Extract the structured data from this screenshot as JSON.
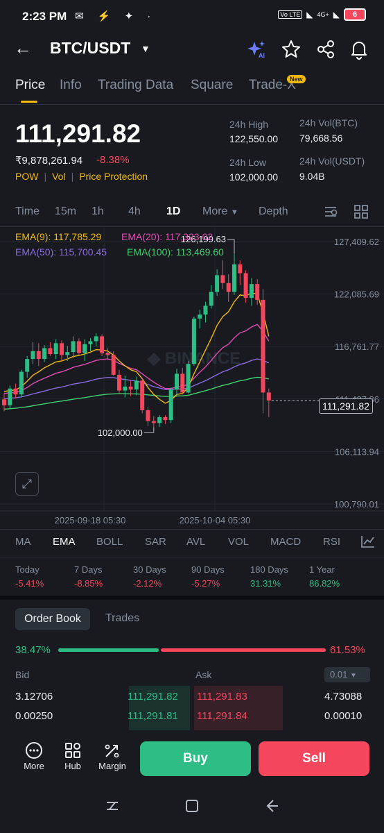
{
  "status_bar": {
    "time": "2:23 PM",
    "left_icons": "✉ ⚡ ✦ ·",
    "net1": "Vo LTE",
    "net2": "4G+",
    "battery": "6"
  },
  "header": {
    "pair": "BTC/USDT",
    "icons": [
      "ai-sparkle-icon",
      "star-icon",
      "share-icon",
      "bell-icon"
    ]
  },
  "tabs": [
    {
      "label": "Price"
    },
    {
      "label": "Info"
    },
    {
      "label": "Trading Data"
    },
    {
      "label": "Square"
    },
    {
      "label": "Trade-X"
    }
  ],
  "tab_badge": "New",
  "price": {
    "last": "111,291.82",
    "inr": "₹9,878,261.94",
    "change": "-8.38%",
    "tags": [
      "POW",
      "Vol",
      "Price Protection"
    ]
  },
  "stats": {
    "high_label": "24h High",
    "high_value": "122,550.00",
    "low_label": "24h Low",
    "low_value": "102,000.00",
    "vol_btc_label": "24h Vol(BTC)",
    "vol_btc_value": "79,668.56",
    "vol_usdt_label": "24h Vol(USDT)",
    "vol_usdt_value": "9.04B"
  },
  "timeframes": [
    "Time",
    "15m",
    "1h",
    "4h",
    "1D",
    "More",
    "Depth"
  ],
  "active_timeframe": "1D",
  "chart_data": {
    "type": "candlestick",
    "watermark": "BINANCE",
    "ema_labels": {
      "ema9": "EMA(9): 117,785.29",
      "ema20": "EMA(20): 117,323.02",
      "ema50": "EMA(50): 115,700.45",
      "ema100": "EMA(100): 113,469.60"
    },
    "colors": {
      "ema9": "#f0b90b",
      "ema20": "#e04bb3",
      "ema50": "#8c6ce0",
      "ema100": "#3fd16f",
      "up": "#2ebd85",
      "down": "#f6465d"
    },
    "y_ticks": [
      "127,409.62",
      "122,085.69",
      "116,761.77",
      "111,437.86",
      "106,113.94",
      "100,790.01"
    ],
    "x_ticks": [
      "2025-09-18 05:30",
      "2025-10-04 05:30"
    ],
    "ylim": [
      100790.01,
      127409.62
    ],
    "current_price": "111,291.82",
    "max_label": "126,199.63",
    "min_label": "102,000.00",
    "candles": [
      [
        111400,
        112000,
        110200,
        110800
      ],
      [
        110800,
        112800,
        110500,
        112500
      ],
      [
        112500,
        113000,
        111500,
        111900
      ],
      [
        111900,
        114400,
        111600,
        114200
      ],
      [
        114200,
        115800,
        113600,
        115500
      ],
      [
        115500,
        117200,
        115000,
        116300
      ],
      [
        116300,
        117100,
        114800,
        115500
      ],
      [
        115500,
        116900,
        115200,
        116600
      ],
      [
        116600,
        117200,
        115800,
        116000
      ],
      [
        116000,
        117500,
        115500,
        117100
      ],
      [
        117100,
        117400,
        115300,
        115900
      ],
      [
        115900,
        116800,
        115300,
        116200
      ],
      [
        116200,
        117800,
        115600,
        117300
      ],
      [
        117300,
        117600,
        115900,
        116100
      ],
      [
        116100,
        117500,
        115300,
        117000
      ],
      [
        117000,
        117600,
        116300,
        117300
      ],
      [
        117300,
        118100,
        116800,
        117800
      ],
      [
        117800,
        118000,
        115800,
        116100
      ],
      [
        116100,
        116600,
        115500,
        115900
      ],
      [
        115900,
        116300,
        113800,
        113900
      ],
      [
        113900,
        114400,
        112000,
        112300
      ],
      [
        112300,
        113800,
        111600,
        112700
      ],
      [
        112700,
        113300,
        111700,
        112400
      ],
      [
        112400,
        113700,
        111800,
        113300
      ],
      [
        113300,
        113600,
        110000,
        110300
      ],
      [
        110300,
        110600,
        108700,
        109200
      ],
      [
        109200,
        109700,
        108600,
        109000
      ],
      [
        109000,
        109800,
        108600,
        109600
      ],
      [
        109600,
        109800,
        108900,
        109300
      ],
      [
        109300,
        112600,
        109000,
        112400
      ],
      [
        112400,
        114500,
        111800,
        114000
      ],
      [
        114000,
        114600,
        111900,
        112100
      ],
      [
        112100,
        115300,
        112000,
        115000
      ],
      [
        115000,
        119800,
        114800,
        119600
      ],
      [
        119600,
        120500,
        118600,
        120000
      ],
      [
        120000,
        121300,
        119200,
        120900
      ],
      [
        120900,
        123000,
        120600,
        122300
      ],
      [
        122300,
        124600,
        121900,
        124000
      ],
      [
        124000,
        125500,
        122600,
        123200
      ],
      [
        123200,
        124100,
        121300,
        122300
      ],
      [
        122300,
        126200,
        122000,
        125100
      ],
      [
        125100,
        125500,
        123000,
        124200
      ],
      [
        124200,
        124500,
        121200,
        121700
      ],
      [
        121700,
        123700,
        120900,
        123100
      ],
      [
        123100,
        123600,
        121000,
        121500
      ],
      [
        121500,
        122600,
        110000,
        112100
      ],
      [
        112100,
        112500,
        109600,
        111292
      ]
    ],
    "ema9": [
      112200,
      112300,
      112350,
      112700,
      113250,
      113850,
      114200,
      114600,
      114900,
      115200,
      115300,
      115500,
      115750,
      115850,
      116000,
      116200,
      116450,
      116400,
      116300,
      115900,
      115300,
      114800,
      114400,
      114200,
      113500,
      112600,
      111900,
      111400,
      111000,
      111300,
      111900,
      112000,
      112600,
      114000,
      115200,
      116400,
      117600,
      118900,
      119800,
      120300,
      121300,
      122000,
      121900,
      122200,
      122100,
      120200,
      117800
    ],
    "ema20": [
      112000,
      112050,
      112100,
      112300,
      112600,
      113000,
      113300,
      113550,
      113800,
      114050,
      114200,
      114400,
      114650,
      114800,
      114950,
      115150,
      115350,
      115450,
      115500,
      115350,
      115050,
      114800,
      114550,
      114400,
      114000,
      113550,
      113150,
      112800,
      112500,
      112500,
      112650,
      112700,
      112950,
      113550,
      114150,
      114700,
      115350,
      116050,
      116650,
      117000,
      117650,
      118150,
      118350,
      118750,
      119000,
      118300,
      117300
    ],
    "ema50": [
      111500,
      111530,
      111560,
      111650,
      111800,
      111950,
      112100,
      112250,
      112400,
      112550,
      112650,
      112800,
      112950,
      113050,
      113150,
      113300,
      113450,
      113550,
      113620,
      113600,
      113500,
      113420,
      113330,
      113270,
      113100,
      112900,
      112700,
      112550,
      112400,
      112400,
      112450,
      112450,
      112550,
      112800,
      113050,
      113300,
      113600,
      113900,
      114200,
      114400,
      114700,
      114950,
      115100,
      115350,
      115500,
      115350,
      115100
    ],
    "ema100": [
      110400,
      110450,
      110500,
      110570,
      110650,
      110750,
      110850,
      110950,
      111050,
      111150,
      111230,
      111320,
      111420,
      111500,
      111580,
      111680,
      111780,
      111860,
      111930,
      111960,
      111970,
      111970,
      111960,
      111960,
      111920,
      111860,
      111800,
      111750,
      111700,
      111710,
      111750,
      111760,
      111820,
      111970,
      112120,
      112280,
      112450,
      112640,
      112820,
      112950,
      113130,
      113290,
      113390,
      113540,
      113640,
      113600,
      113470
    ]
  },
  "indicators": [
    "MA",
    "EMA",
    "BOLL",
    "SAR",
    "AVL",
    "VOL",
    "MACD",
    "RSI"
  ],
  "active_indicator": "EMA",
  "performance": [
    {
      "label": "Today",
      "value": "-5.41%",
      "dir": "down"
    },
    {
      "label": "7 Days",
      "value": "-8.85%",
      "dir": "down"
    },
    {
      "label": "30 Days",
      "value": "-2.12%",
      "dir": "down"
    },
    {
      "label": "90 Days",
      "value": "-5.27%",
      "dir": "down"
    },
    {
      "label": "180 Days",
      "value": "31.31%",
      "dir": "up"
    },
    {
      "label": "1 Year",
      "value": "86.82%",
      "dir": "up"
    }
  ],
  "order_book": {
    "tab_active": "Order Book",
    "tab_other": "Trades",
    "bid_pct": "38.47%",
    "ask_pct": "61.53%",
    "bid_ratio": 0.3847,
    "bid_label": "Bid",
    "ask_label": "Ask",
    "precision": "0.01",
    "rows": [
      {
        "bid_qty": "3.12706",
        "bid_price": "111,291.82",
        "ask_price": "111,291.83",
        "ask_qty": "4.73088"
      },
      {
        "bid_qty": "0.00250",
        "bid_price": "111,291.81",
        "ask_price": "111,291.84",
        "ask_qty": "0.00010"
      }
    ]
  },
  "bottom_nav": [
    {
      "label": "More",
      "icon": "more-dots-icon"
    },
    {
      "label": "Hub",
      "icon": "hub-grid-icon"
    },
    {
      "label": "Margin",
      "icon": "margin-icon"
    }
  ],
  "buy_label": "Buy",
  "sell_label": "Sell"
}
